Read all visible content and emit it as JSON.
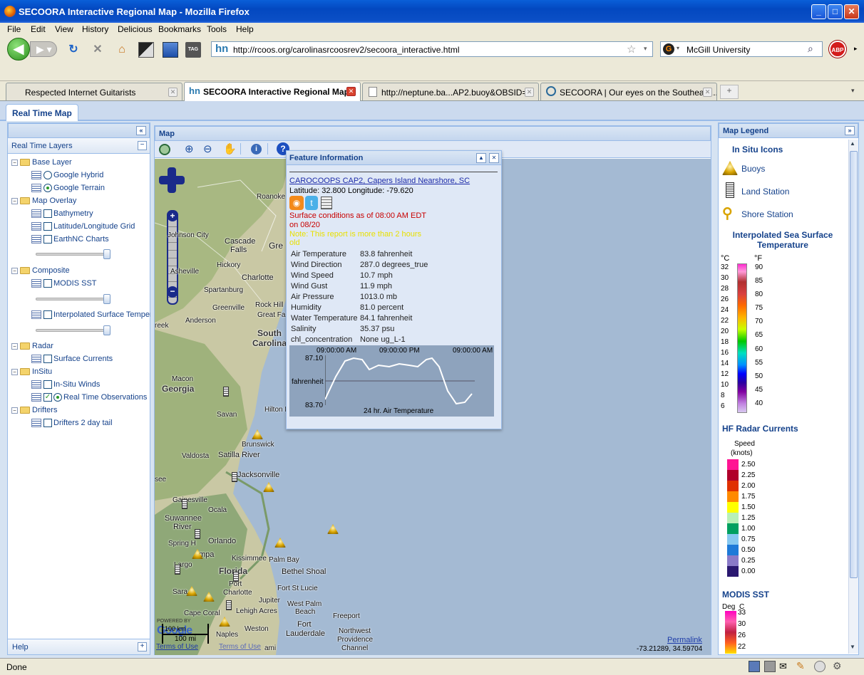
{
  "window": {
    "title": "SECOORA Interactive Regional Map - Mozilla Firefox"
  },
  "menu": [
    "File",
    "Edit",
    "View",
    "History",
    "Delicious",
    "Bookmarks",
    "Tools",
    "Help"
  ],
  "nav": {
    "url": "http://rcoos.org/carolinasrcoosrev2/secoora_interactive.html",
    "search_value": "McGill University",
    "abp_label": "ABP",
    "tag_label": "TAG"
  },
  "tabs": [
    {
      "label": "Respected Internet Guitarists"
    },
    {
      "label": "SECOORA Interactive Regional Map"
    },
    {
      "label": "http://neptune.ba...AP2.buoy&OBSID=4"
    },
    {
      "label": "SECOORA | Our eyes on the Southeast..."
    }
  ],
  "app": {
    "tab": "Real Time Map",
    "map_title": "Map",
    "legend_title": "Map Legend",
    "help": "Help"
  },
  "layers": {
    "title": "Real Time Layers",
    "base_layer": "Base Layer",
    "google_hybrid": "Google Hybrid",
    "google_terrain": "Google Terrain",
    "map_overlay": "Map Overlay",
    "bathymetry": "Bathymetry",
    "latlon": "Latitude/Longitude Grid",
    "earthnc": "EarthNC Charts",
    "composite": "Composite",
    "modis": "MODIS SST",
    "interp": "Interpolated Surface Temper",
    "radar": "Radar",
    "surface_currents": "Surface Currents",
    "insitu": "InSitu",
    "insitu_winds": "In-Situ Winds",
    "rto": "Real Time Observations",
    "drifters": "Drifters",
    "drifters_tail": "Drifters 2 day tail"
  },
  "feature": {
    "title": "Feature Information",
    "station": "CAROCOOPS CAP2, Capers Island Nearshore, SC",
    "latlon": "Latitude: 32.800 Longitude: -79.620",
    "surface1": "Surface conditions as of 08:00 AM EDT",
    "surface2": "on 08/20",
    "note1": "Note: This report is more than 2 hours",
    "note2": "old",
    "obs": [
      {
        "k": "Air Temperature",
        "v": "83.8 fahrenheit"
      },
      {
        "k": "Wind Direction",
        "v": "287.0 degrees_true"
      },
      {
        "k": "Wind Speed",
        "v": "10.7 mph"
      },
      {
        "k": "Wind Gust",
        "v": "11.9 mph"
      },
      {
        "k": "Air Pressure",
        "v": "1013.0 mb"
      },
      {
        "k": "Humidity",
        "v": "81.0 percent"
      },
      {
        "k": "Water Temperature",
        "v": "84.1 fahrenheit"
      },
      {
        "k": "Salinity",
        "v": "35.37 psu"
      },
      {
        "k": "chl_concentration",
        "v": "None ug_L-1"
      }
    ],
    "chart": {
      "t1": "09:00:00 AM",
      "t2": "09:00:00 PM",
      "t3": "09:00:00 AM",
      "ymax": "87.10",
      "ymid": "fahrenheit",
      "ymin": "83.70",
      "caption": "24 hr. Air Temperature"
    }
  },
  "map_labels": {
    "cities": [
      "Roanoke",
      "Johnson City",
      "Cascade",
      "Falls",
      "Gre",
      "Asheville",
      "Hickory",
      "Charlotte",
      "Spartanburg",
      "Greenville",
      "Rock Hill",
      "Great Fa",
      "Anderson",
      "South",
      "Carolina",
      "reek",
      "Macon",
      "Georgia",
      "Savan",
      "Hilton H",
      "Brunswick",
      "Valdosta",
      "Satilla River",
      "Jacksonville",
      "see",
      "Gainesville",
      "Ocala",
      "Suwannee",
      "River",
      "Spring H",
      "Orlando",
      "mpa",
      "Largo",
      "Florida",
      "Kissimmee",
      "Palm Bay",
      "Bethel Shoal",
      "Port",
      "Charlotte",
      "Fort St Lucie",
      "Sara",
      "Jupiter",
      "West Palm",
      "Beach",
      "Cape Coral",
      "Lehigh Acres",
      "Freeport",
      "Fort",
      "Lauderdale",
      "Northwest",
      "Providence",
      "Channel",
      "Naples",
      "Weston",
      "ami"
    ],
    "powered": "POWERED BY",
    "scale_km": "100 km",
    "scale_mi": "100 mi",
    "terms": "Terms of Use",
    "terms2": "Terms of Use",
    "permalink": "Permalink",
    "coords": "-73.21289, 34.59704"
  },
  "legend": {
    "insitu_title": "In Situ Icons",
    "buoys": "Buoys",
    "land": "Land Station",
    "shore": "Shore Station",
    "sst_title": "Interpolated Sea Surface Temperature",
    "c_unit": "°C",
    "f_unit": "°F",
    "c_ticks": [
      "32",
      "30",
      "28",
      "26",
      "24",
      "22",
      "20",
      "18",
      "16",
      "14",
      "12",
      "10",
      "8",
      "6"
    ],
    "f_ticks": [
      "90",
      "85",
      "80",
      "75",
      "70",
      "65",
      "60",
      "55",
      "50",
      "45",
      "40"
    ],
    "hf_title": "HF Radar Currents",
    "speed": "Speed",
    "knots": "(knots)",
    "speeds": [
      "2.50",
      "2.25",
      "2.00",
      "1.75",
      "1.50",
      "1.25",
      "1.00",
      "0.75",
      "0.50",
      "0.25",
      "0.00"
    ],
    "speed_colors": [
      "#ff1493",
      "#b0002a",
      "#e03000",
      "#ff8a00",
      "#ffff00",
      "#b8f0b8",
      "#00a060",
      "#86c8f0",
      "#1e7ad8",
      "#8a7ac8",
      "#2a1870"
    ],
    "modis_title": "MODIS SST",
    "deg": "Deg",
    "c": "C",
    "modis_ticks": [
      "33",
      "30",
      "26",
      "22"
    ]
  },
  "status": {
    "text": "Done"
  }
}
